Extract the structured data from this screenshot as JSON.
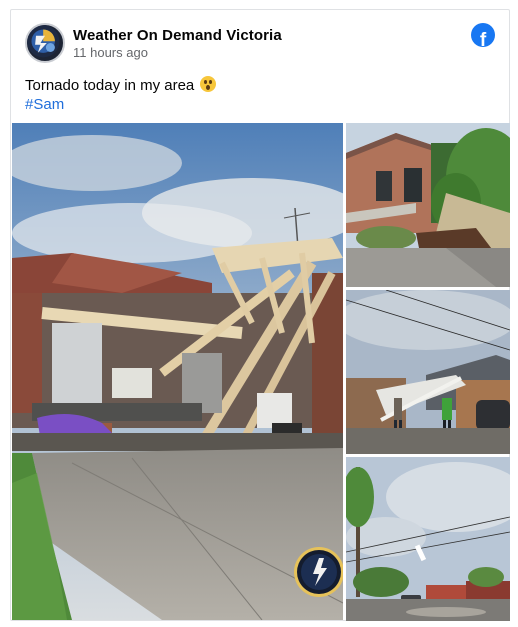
{
  "post": {
    "page_name": "Weather On Demand Victoria",
    "timestamp": "11 hours ago",
    "text": "Tornado today in my area",
    "emoji": "astonished-face",
    "hashtag": "#Sam"
  },
  "icons": {
    "facebook": "facebook-logo-icon",
    "avatar": "weather-on-demand-logo"
  },
  "colors": {
    "facebook_blue": "#1877f2",
    "hashtag": "#216fdb",
    "meta_text": "#65676b"
  },
  "photos": [
    {
      "name": "garage-collapse-photo"
    },
    {
      "name": "damaged-fence-photo"
    },
    {
      "name": "people-inspecting-damage-photo"
    },
    {
      "name": "storm-street-photo"
    }
  ]
}
